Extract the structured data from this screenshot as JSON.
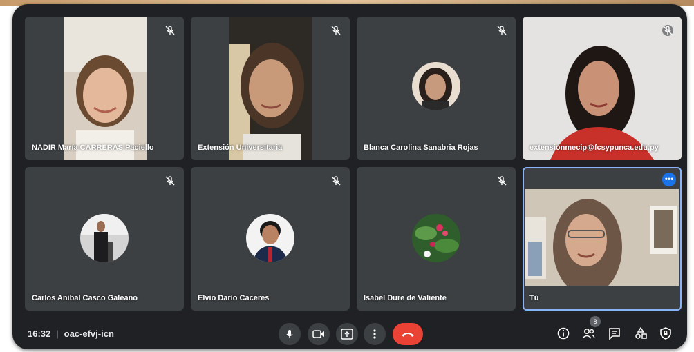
{
  "participants": [
    {
      "name": "NADIR María CARRERAS Paciello",
      "muted": true
    },
    {
      "name": "Extensión Universitaria",
      "muted": true
    },
    {
      "name": "Blanca Carolina Sanabria Rojas",
      "muted": true
    },
    {
      "name": "extensionmecip@fcsypunca.edu.py",
      "muted": true
    },
    {
      "name": "Carlos Aníbal Casco Galeano",
      "muted": true
    },
    {
      "name": "Elvio Darío Caceres",
      "muted": true
    },
    {
      "name": "Isabel Dure de Valiente",
      "muted": true
    },
    {
      "name": "Tú",
      "muted": false,
      "self": true
    }
  ],
  "meeting": {
    "time": "16:32",
    "separator": "|",
    "code": "oac-efvj-icn"
  },
  "controls": {
    "mic_icon": "mic-icon",
    "camera_icon": "camera-icon",
    "present_icon": "present-icon",
    "more_icon": "more-vert-icon",
    "end_call_icon": "end-call-icon"
  },
  "right_controls": {
    "participant_count": "8",
    "icons": [
      "info-icon",
      "people-icon",
      "chat-icon",
      "activities-icon",
      "host-controls-icon"
    ]
  },
  "colors": {
    "background": "#202124",
    "tile": "#3c4043",
    "end_call": "#ea4335",
    "accent": "#1a73e8",
    "highlight": "#8ab4f8"
  }
}
